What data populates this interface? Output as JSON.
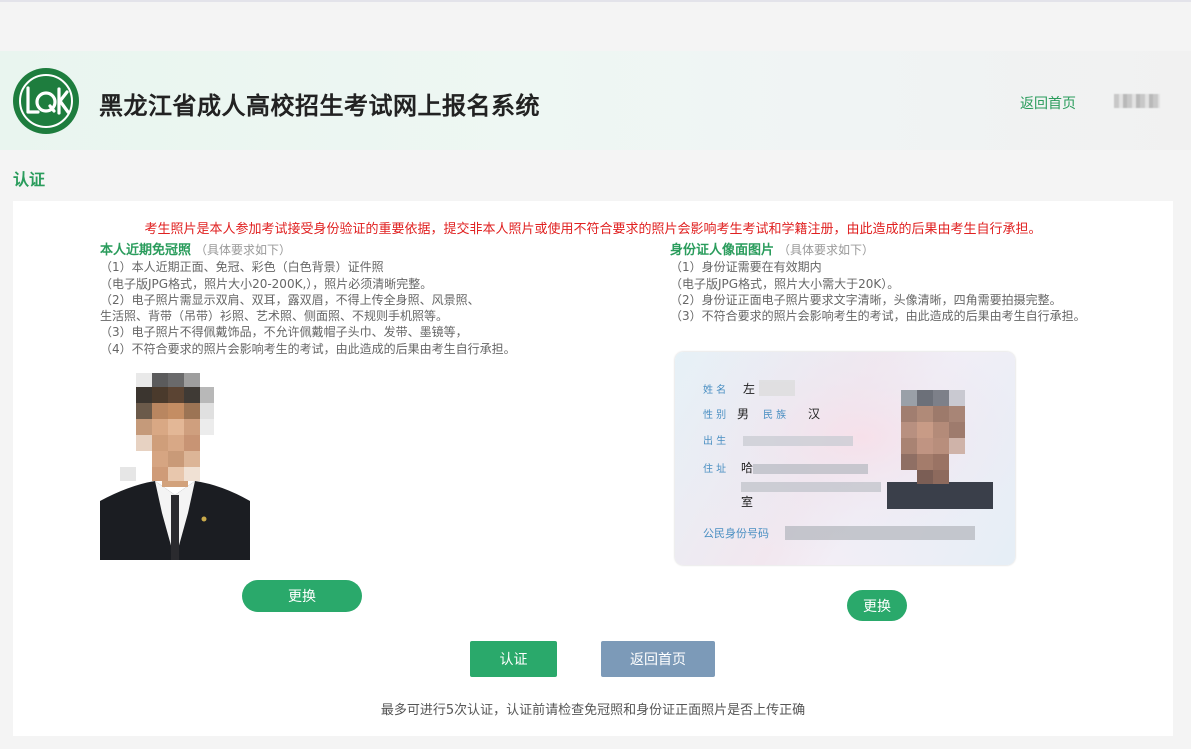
{
  "header": {
    "site_title": "黑龙江省成人高校招生考试网上报名系统",
    "home_link": "返回首页",
    "logo_icon": "lqk-logo-icon",
    "brand_color": "#1e7d3e"
  },
  "page": {
    "section_label": "认证",
    "warning": "考生照片是本人参加考试接受身份验证的重要依据，提交非本人照片或使用不符合要求的照片会影响考生考试和学籍注册，由此造成的后果由考生自行承担。"
  },
  "left_panel": {
    "title": "本人近期免冠照",
    "hint": "（具体要求如下）",
    "requirements": [
      "（1）本人近期正面、免冠、彩色（白色背景）证件照",
      "（电子版JPG格式，照片大小20-200K,），照片必须清晰完整。",
      "（2）电子照片需显示双肩、双耳，露双眉，不得上传全身照、风景照、",
      "生活照、背带（吊带）衫照、艺术照、侧面照、不规则手机照等。",
      "（3）电子照片不得佩戴饰品，不允许佩戴帽子头巾、发带、墨镜等，",
      "（4）不符合要求的照片会影响考生的考试，由此造成的后果由考生自行承担。"
    ],
    "change_button": "更换"
  },
  "right_panel": {
    "title": "身份证人像面图片",
    "hint": "（具体要求如下）",
    "requirements": [
      "（1）身份证需要在有效期内",
      "（电子版JPG格式，照片大小需大于20K）。",
      "（2）身份证正面电子照片要求文字清晰，头像清晰，四角需要拍摄完整。",
      "（3）不符合要求的照片会影响考生的考试，由此造成的后果由考生自行承担。"
    ],
    "id_card": {
      "name_label": "姓 名",
      "name_value": "左",
      "sex_label": "性 别",
      "sex_value": "男",
      "ethnicity_label": "民 族",
      "ethnicity_value": "汉",
      "birth_label": "出 生",
      "address_label": "住 址",
      "address_value_1": "哈",
      "address_value_3": "室",
      "id_number_label": "公民身份号码"
    },
    "change_button": "更换"
  },
  "actions": {
    "verify_button": "认证",
    "back_button": "返回首页",
    "footnote": "最多可进行5次认证，认证前请检查免冠照和身份证正面照片是否上传正确"
  },
  "colors": {
    "accent_green": "#2aa96b",
    "link_green": "#2a9c5c",
    "warning_red": "#e02020",
    "back_button_blue": "#7c9ab8"
  }
}
